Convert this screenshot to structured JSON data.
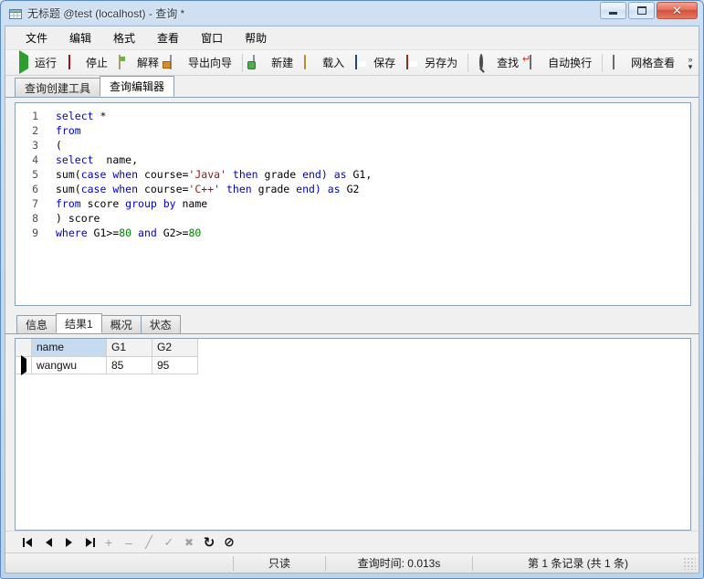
{
  "window": {
    "title": "无标题 @test (localhost) - 查询 *",
    "icon": "table-grid-icon",
    "minimize_label": "最小化",
    "maximize_label": "最大化",
    "close_label": "关闭"
  },
  "menubar": {
    "items": [
      {
        "label": "文件"
      },
      {
        "label": "编辑"
      },
      {
        "label": "格式"
      },
      {
        "label": "查看"
      },
      {
        "label": "窗口"
      },
      {
        "label": "帮助"
      }
    ]
  },
  "toolbar": {
    "groups": [
      {
        "buttons": [
          {
            "label": "运行",
            "icon": "play-icon"
          },
          {
            "label": "停止",
            "icon": "stop-icon"
          },
          {
            "label": "解释",
            "icon": "explain-icon"
          },
          {
            "label": "导出向导",
            "icon": "export-wizard-icon"
          }
        ]
      },
      {
        "buttons": [
          {
            "label": "新建",
            "icon": "new-query-icon"
          },
          {
            "label": "载入",
            "icon": "folder-open-icon"
          },
          {
            "label": "保存",
            "icon": "save-icon"
          },
          {
            "label": "另存为",
            "icon": "save-as-icon"
          }
        ]
      },
      {
        "buttons": [
          {
            "label": "查找",
            "icon": "search-icon"
          },
          {
            "label": "自动换行",
            "icon": "word-wrap-icon"
          }
        ]
      },
      {
        "buttons": [
          {
            "label": "网格查看",
            "icon": "grid-view-icon"
          }
        ]
      }
    ],
    "overflow_label": "»"
  },
  "editor_tabs": [
    {
      "label": "查询创建工具",
      "active": false
    },
    {
      "label": "查询编辑器",
      "active": true
    }
  ],
  "editor": {
    "line_numbers": [
      "1",
      "2",
      "3",
      "4",
      "5",
      "6",
      "7",
      "8",
      "9"
    ],
    "lines": [
      [
        {
          "t": "select ",
          "c": "kw"
        },
        {
          "t": "*",
          "c": "pln"
        }
      ],
      [
        {
          "t": "from",
          "c": "kw"
        }
      ],
      [
        {
          "t": "(",
          "c": "pln"
        }
      ],
      [
        {
          "t": "select",
          "c": "kw"
        },
        {
          "t": "  name,",
          "c": "pln"
        }
      ],
      [
        {
          "t": "sum(",
          "c": "pln"
        },
        {
          "t": "case when ",
          "c": "kw"
        },
        {
          "t": "course=",
          "c": "pln"
        },
        {
          "t": "'Java'",
          "c": "str"
        },
        {
          "t": " then ",
          "c": "kw"
        },
        {
          "t": "grade ",
          "c": "pln"
        },
        {
          "t": "end)",
          "c": "kw"
        },
        {
          "t": " ",
          "c": "pln"
        },
        {
          "t": "as",
          "c": "kw"
        },
        {
          "t": " G1,",
          "c": "pln"
        }
      ],
      [
        {
          "t": "sum(",
          "c": "pln"
        },
        {
          "t": "case when ",
          "c": "kw"
        },
        {
          "t": "course=",
          "c": "pln"
        },
        {
          "t": "'C++'",
          "c": "str"
        },
        {
          "t": " then ",
          "c": "kw"
        },
        {
          "t": "grade ",
          "c": "pln"
        },
        {
          "t": "end)",
          "c": "kw"
        },
        {
          "t": " ",
          "c": "pln"
        },
        {
          "t": "as",
          "c": "kw"
        },
        {
          "t": " G2",
          "c": "pln"
        }
      ],
      [
        {
          "t": "from ",
          "c": "kw"
        },
        {
          "t": "score ",
          "c": "pln"
        },
        {
          "t": "group by ",
          "c": "kw"
        },
        {
          "t": "name",
          "c": "pln"
        }
      ],
      [
        {
          "t": ") score",
          "c": "pln"
        }
      ],
      [
        {
          "t": "where ",
          "c": "kw"
        },
        {
          "t": "G1>=",
          "c": "pln"
        },
        {
          "t": "80",
          "c": "num"
        },
        {
          "t": " and ",
          "c": "kw"
        },
        {
          "t": "G2>=",
          "c": "pln"
        },
        {
          "t": "80",
          "c": "num"
        }
      ]
    ],
    "plain_text": "select *\nfrom\n(\nselect  name,\nsum(case when course='Java' then grade end) as G1,\nsum(case when course='C++' then grade end) as G2\nfrom score group by name\n) score\nwhere G1>=80 and G2>=80"
  },
  "result_tabs": [
    {
      "label": "信息",
      "active": false
    },
    {
      "label": "结果1",
      "active": true
    },
    {
      "label": "概况",
      "active": false
    },
    {
      "label": "状态",
      "active": false
    }
  ],
  "grid": {
    "columns": [
      {
        "label": "name",
        "selected": true
      },
      {
        "label": "G1",
        "selected": false
      },
      {
        "label": "G2",
        "selected": false
      }
    ],
    "rows": [
      {
        "current": true,
        "cells": [
          "wangwu",
          "85",
          "95"
        ]
      }
    ]
  },
  "navbar": {
    "buttons": [
      {
        "icon": "first-record-icon",
        "label": "第一条记录",
        "disabled": false
      },
      {
        "icon": "previous-record-icon",
        "label": "上一条记录",
        "disabled": false
      },
      {
        "icon": "next-record-icon",
        "label": "下一条记录",
        "disabled": false
      },
      {
        "icon": "last-record-icon",
        "label": "最后一条记录",
        "disabled": false
      },
      {
        "icon": "insert-record-icon",
        "label": "插入记录",
        "disabled": true
      },
      {
        "icon": "delete-record-icon",
        "label": "删除记录",
        "disabled": true
      },
      {
        "icon": "edit-record-icon",
        "label": "编辑记录",
        "disabled": true
      },
      {
        "icon": "apply-changes-icon",
        "label": "应用改变",
        "disabled": true
      },
      {
        "icon": "cancel-changes-icon",
        "label": "放弃改变",
        "disabled": true
      },
      {
        "icon": "refresh-icon",
        "label": "刷新",
        "disabled": false
      },
      {
        "icon": "stop-loading-icon",
        "label": "停止",
        "disabled": false
      }
    ]
  },
  "statusbar": {
    "readonly": "只读",
    "query_time": "查询时间: 0.013s",
    "record_info": "第 1 条记录 (共 1 条)"
  },
  "colors": {
    "keyword": "#0000c8",
    "string": "#8b1a1a",
    "number": "#008000",
    "selection": "#c5dcf0",
    "frame": "#bcd3ea"
  }
}
